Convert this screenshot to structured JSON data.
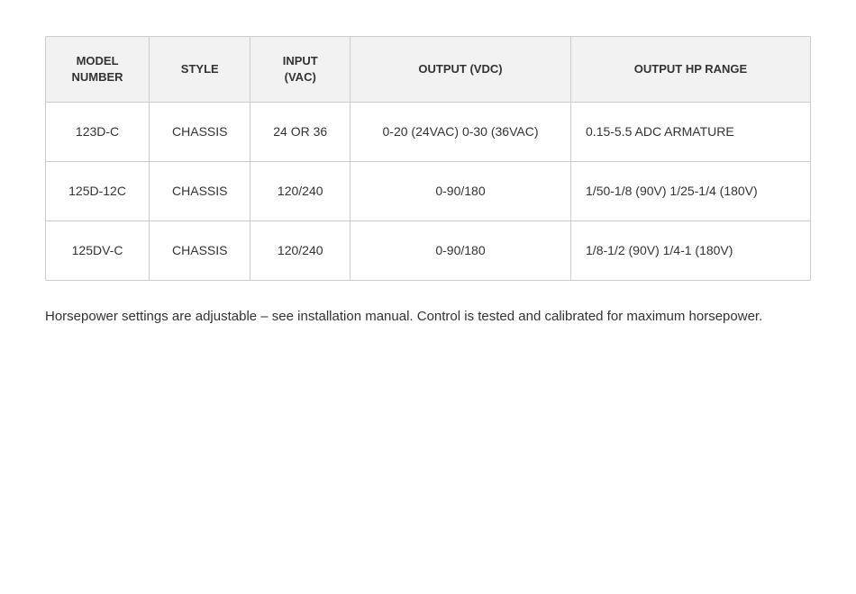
{
  "table": {
    "headers": [
      {
        "id": "model-number",
        "label": "MODEL\nNUMBER"
      },
      {
        "id": "style",
        "label": "STYLE"
      },
      {
        "id": "input-vac",
        "label": "INPUT\n(VAC)"
      },
      {
        "id": "output-vdc",
        "label": "OUTPUT (VDC)"
      },
      {
        "id": "output-hp-range",
        "label": "OUTPUT HP RANGE"
      }
    ],
    "rows": [
      {
        "model": "123D-C",
        "style": "CHASSIS",
        "input": "24 OR 36",
        "output_vdc": "0-20 (24VAC) 0-30 (36VAC)",
        "output_hp": "0.15-5.5 ADC ARMATURE"
      },
      {
        "model": "125D-12C",
        "style": "CHASSIS",
        "input": "120/240",
        "output_vdc": "0-90/180",
        "output_hp": "1/50-1/8 (90V) 1/25-1/4 (180V)"
      },
      {
        "model": "125DV-C",
        "style": "CHASSIS",
        "input": "120/240",
        "output_vdc": "0-90/180",
        "output_hp": "1/8-1/2 (90V) 1/4-1 (180V)"
      }
    ]
  },
  "footnote": "Horsepower settings are adjustable – see installation manual. Control is tested and calibrated for maximum horsepower."
}
